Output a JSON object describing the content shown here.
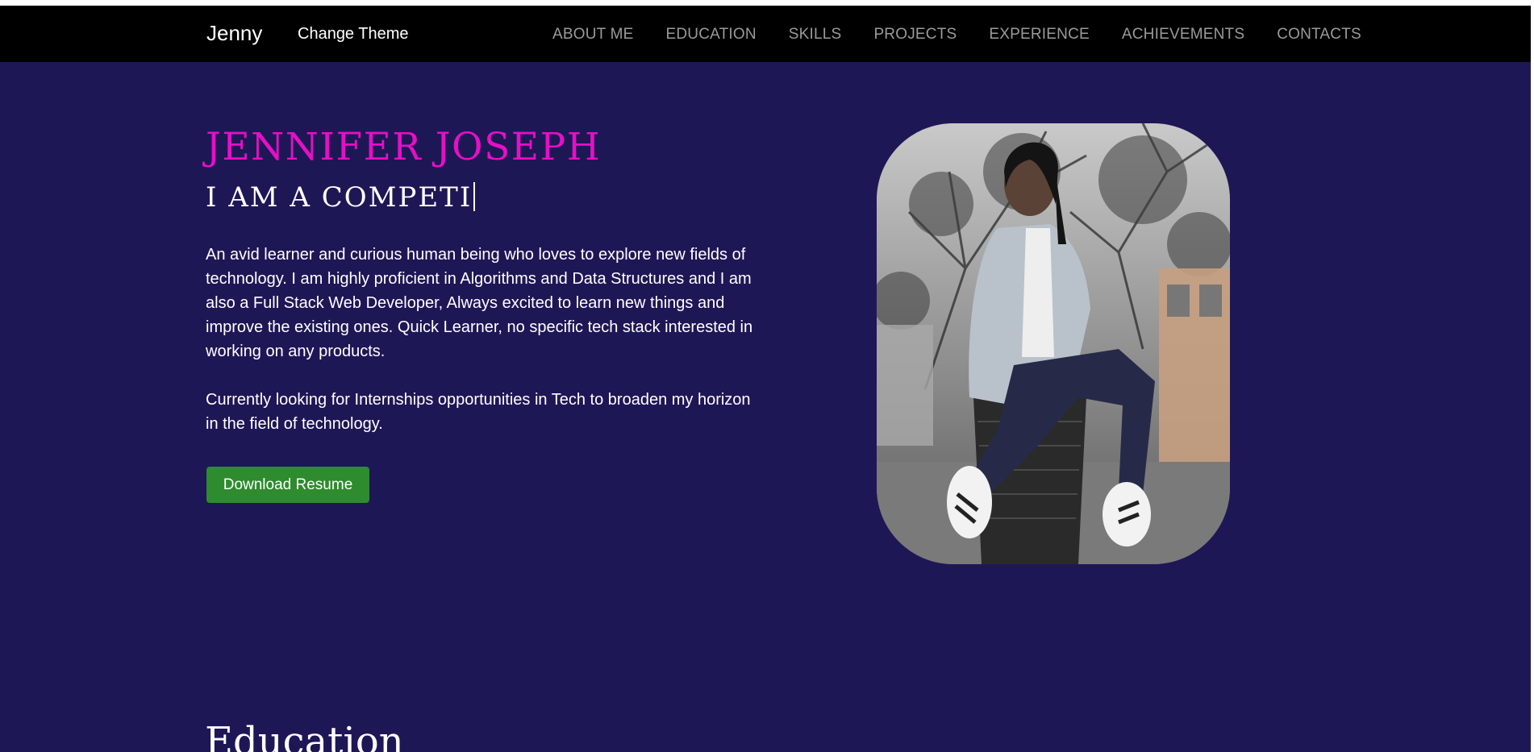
{
  "navbar": {
    "brand": "Jenny",
    "theme_toggle": "Change Theme",
    "links": [
      "ABOUT ME",
      "EDUCATION",
      "SKILLS",
      "PROJECTS",
      "EXPERIENCE",
      "ACHIEVEMENTS",
      "CONTACTS"
    ]
  },
  "hero": {
    "name": "JENNIFER JOSEPH",
    "typed_text": "I AM A COMPETI",
    "bio_paragraph": "An avid learner and curious human being who loves to explore new fields of technology. I am highly proficient in Algorithms and Data Structures and I am also a Full Stack Web Developer, Always excited to learn new things and improve the existing ones. Quick Learner, no specific tech stack interested in working on any products.",
    "bio_paragraph_2": "Currently looking for Internships opportunities in Tech to broaden my horizon in the field of technology.",
    "resume_button": "Download Resume"
  },
  "education": {
    "title": "Education"
  },
  "colors": {
    "background": "#1e1756",
    "navbar": "#000000",
    "name_accent": "#e60fc6",
    "button": "#2e8b2e",
    "nav_link": "#9a9a9a"
  }
}
